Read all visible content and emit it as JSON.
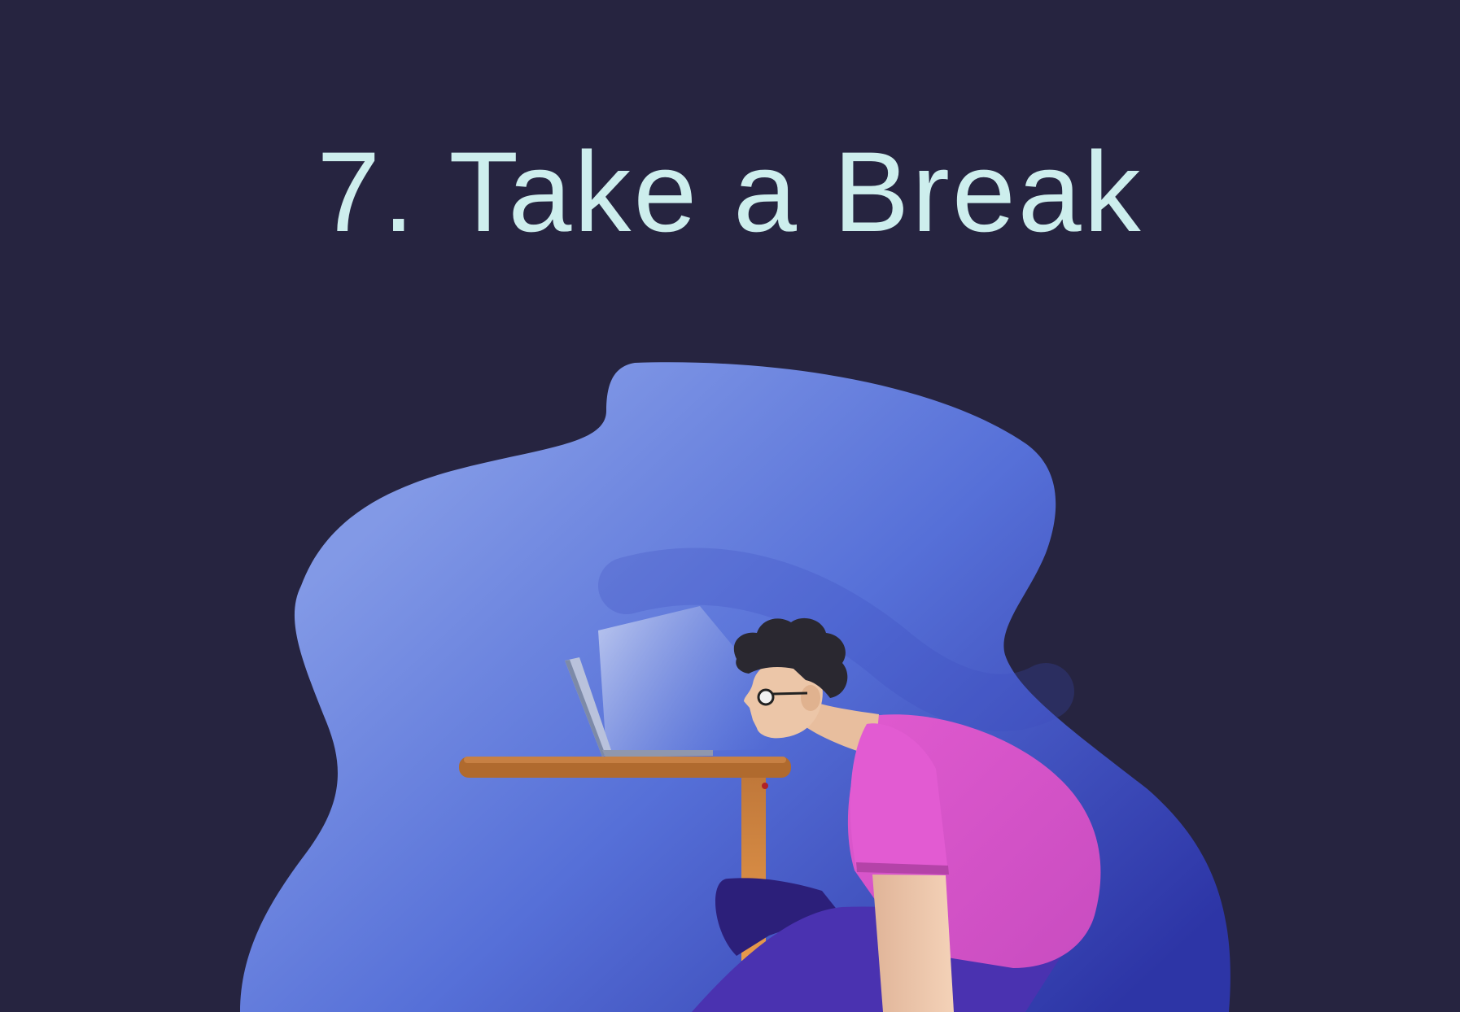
{
  "slide": {
    "title": "7. Take a Break"
  },
  "illustration": {
    "subject": "person-slumped-over-laptop-at-desk",
    "colors": {
      "background": "#262440",
      "title_text": "#cdeeed",
      "blob_light": "#8299e6",
      "blob_mid": "#5670d8",
      "blob_dark": "#3845b6",
      "desk": "#b06a2e",
      "shirt": "#dc58cc",
      "pants": "#4a32b0",
      "hair": "#2a2830",
      "skin": "#ecc6a8"
    }
  }
}
